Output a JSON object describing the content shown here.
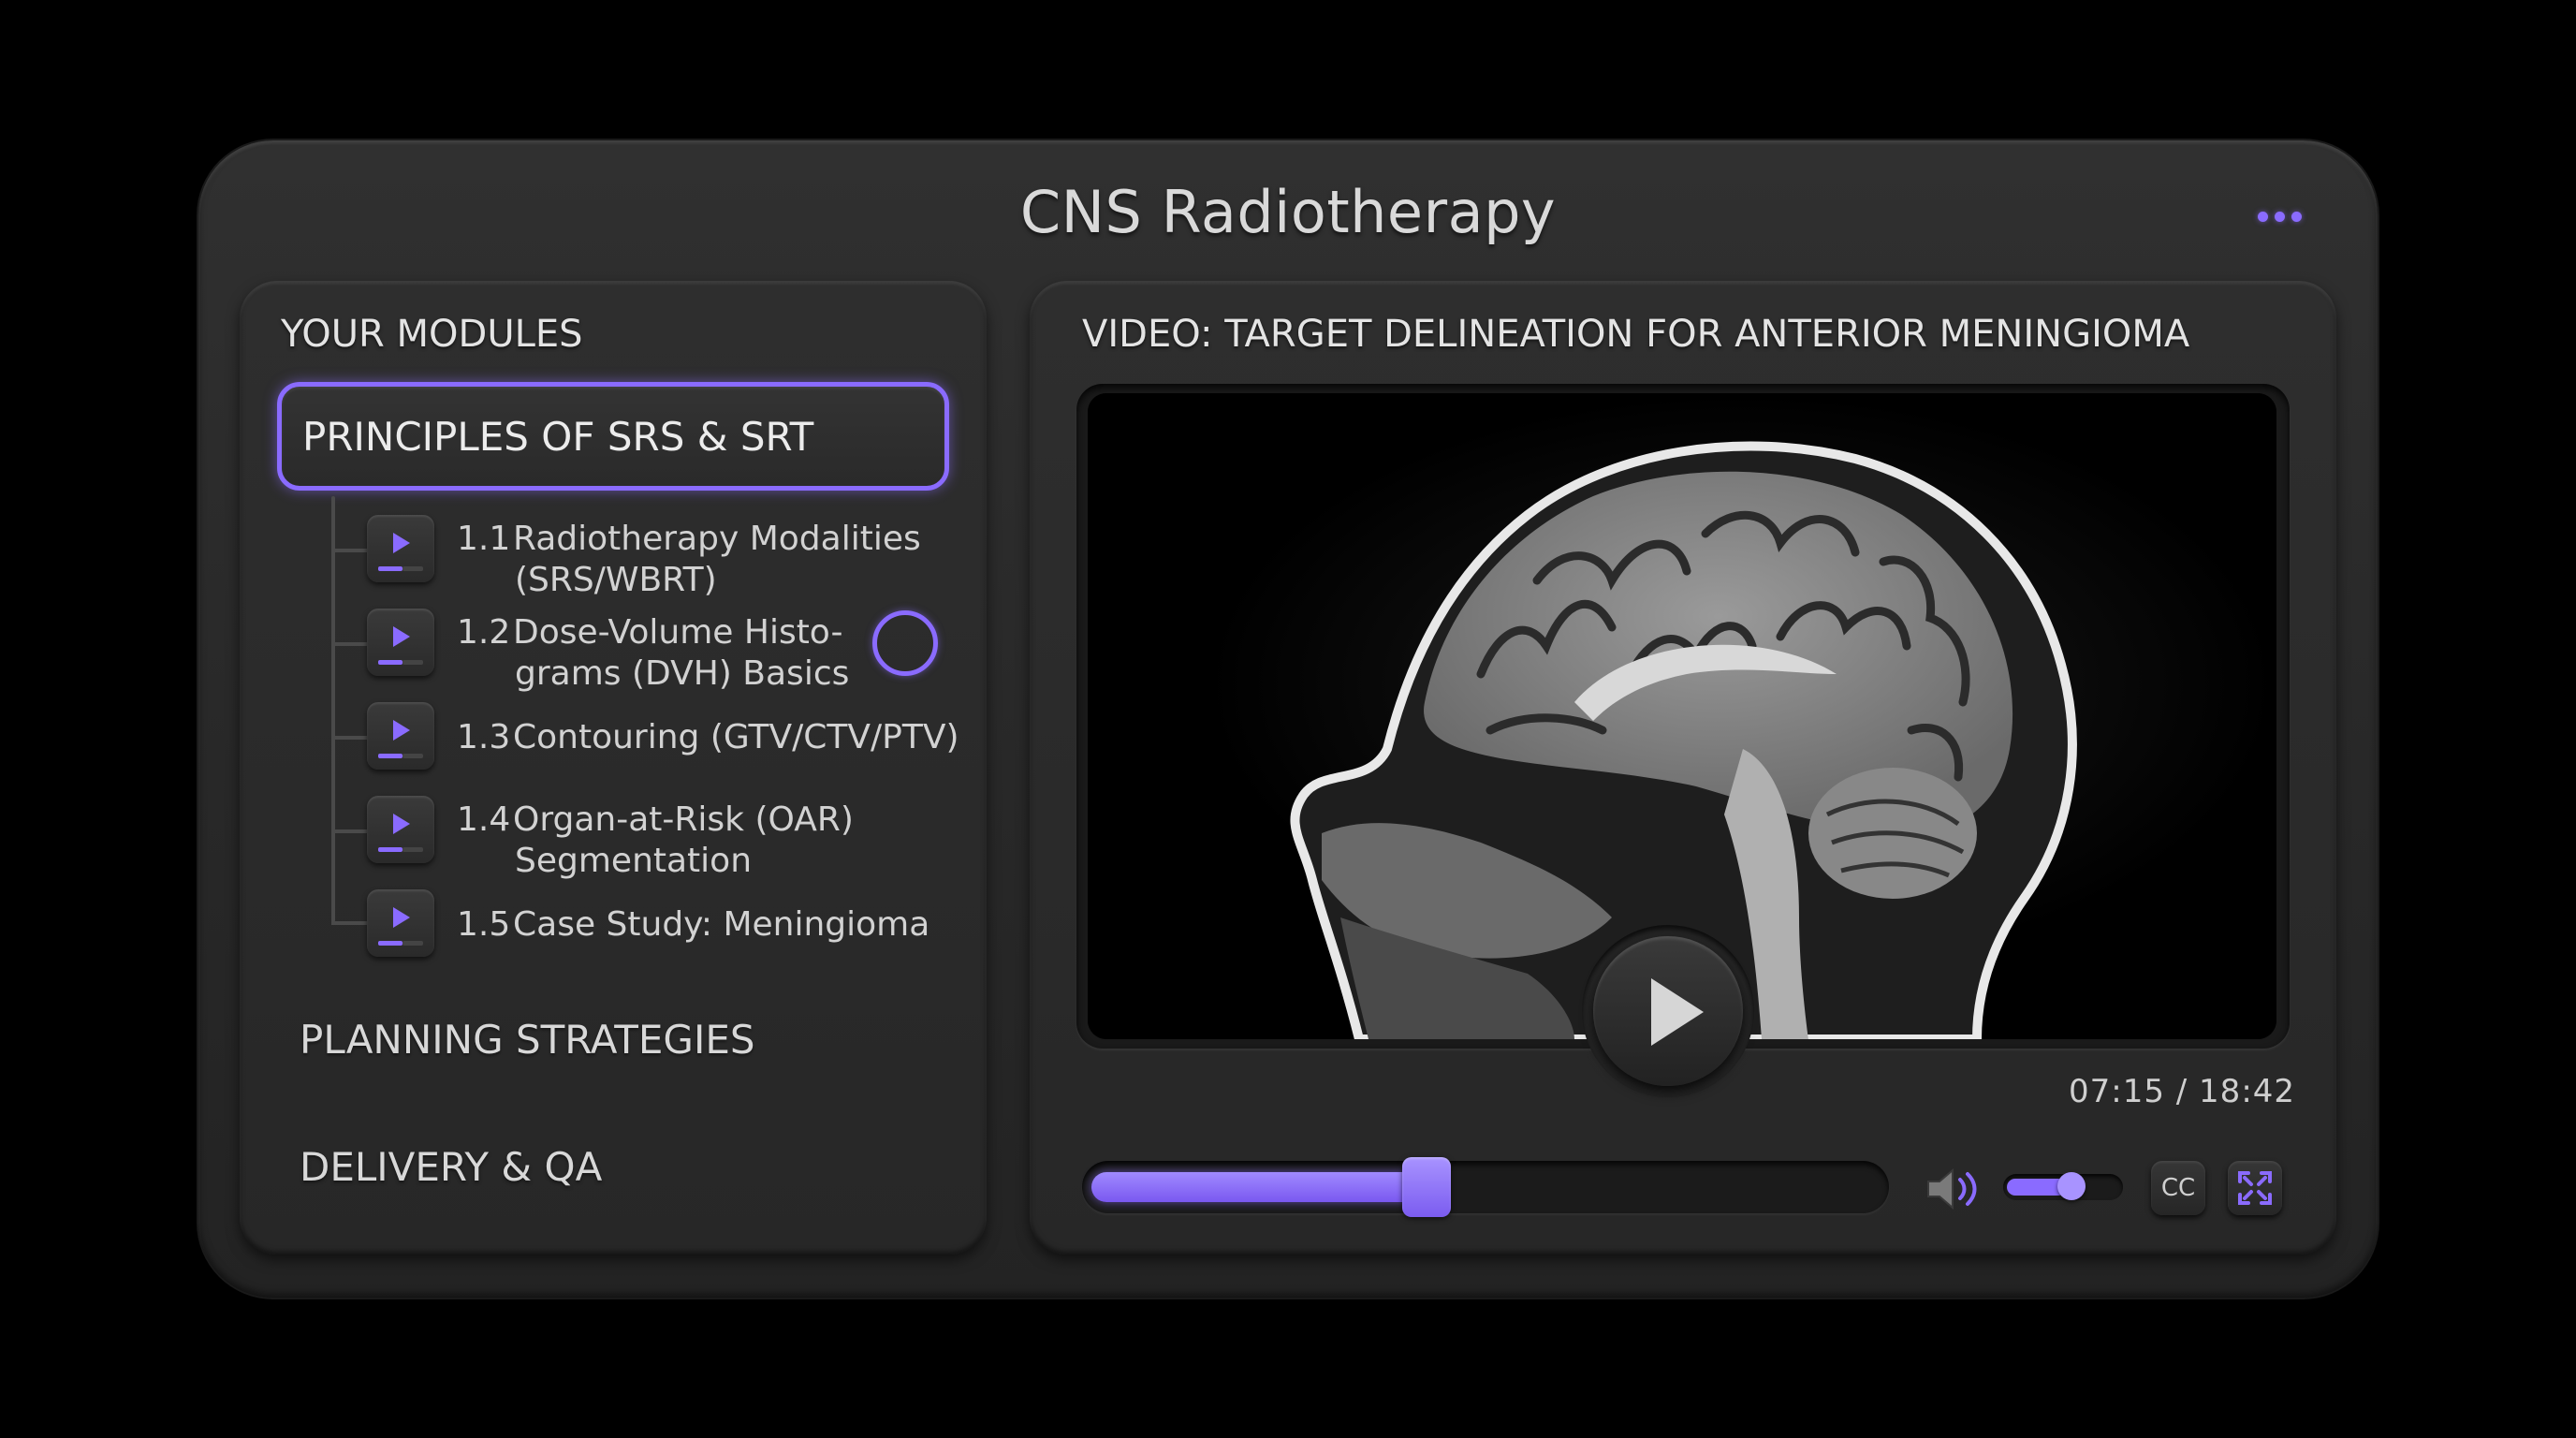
{
  "app": {
    "title": "CNS Radiotherapy"
  },
  "sidebar": {
    "heading": "YOUR MODULES",
    "active_module": "PRINCIPLES OF SRS & SRT",
    "lessons": [
      {
        "num": "1.1",
        "line1": "Radiotherapy Modalities",
        "line2": "(SRS/WBRT)"
      },
      {
        "num": "1.2",
        "line1": "Dose-Volume Histo-",
        "line2": "grams (DVH) Basics"
      },
      {
        "num": "1.3",
        "line1": "Contouring (GTV/CTV/PTV)",
        "line2": ""
      },
      {
        "num": "1.4",
        "line1": "Organ-at-Risk (OAR)",
        "line2": "Segmentation"
      },
      {
        "num": "1.5",
        "line1": "Case Study: Meningioma",
        "line2": ""
      }
    ],
    "other_modules": [
      "PLANNING STRATEGIES",
      "DELIVERY & QA"
    ]
  },
  "video": {
    "heading": "VIDEO: TARGET DELINEATION FOR ANTERIOR MENINGIOMA",
    "time": "07:15 / 18:42",
    "progress_fraction": 0.39,
    "volume_fraction": 0.45,
    "cc_label": "CC"
  },
  "colors": {
    "accent": "#8a6bff",
    "panel": "#2b2b2b",
    "background": "#000000"
  },
  "icons": [
    "more-dots-icon",
    "play-icon",
    "volume-icon",
    "cc-icon",
    "fullscreen-icon",
    "lesson-play-icon"
  ]
}
